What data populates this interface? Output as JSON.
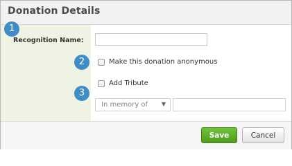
{
  "dialog": {
    "title": "Donation Details"
  },
  "badges": {
    "one": "1",
    "two": "2",
    "three": "3"
  },
  "form": {
    "recognition_label": "Recognition Name:",
    "recognition_value": "",
    "anonymous_label": "Make this donation anonymous",
    "anonymous_checked": false,
    "tribute_label": "Add Tribute",
    "tribute_checked": false,
    "tribute_type_selected": "In memory of",
    "tribute_name_value": ""
  },
  "footer": {
    "save_label": "Save",
    "cancel_label": "Cancel"
  },
  "colors": {
    "accent_badge": "#3f8dc6",
    "save_button": "#5aa827",
    "label_column": "#eef3e4"
  }
}
